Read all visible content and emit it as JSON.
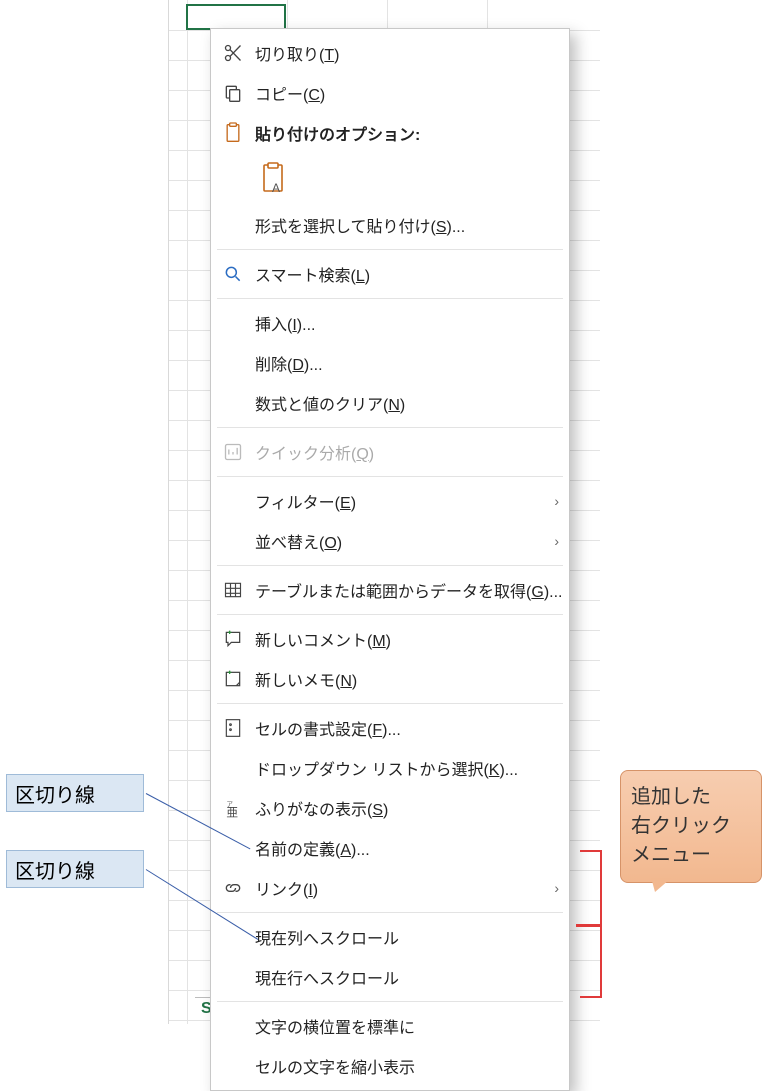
{
  "sheet": {
    "tab_label": "Sl"
  },
  "menu": {
    "cut": "切り取り(<u>T</u>)",
    "copy": "コピー(<u>C</u>)",
    "paste_opts": "貼り付けのオプション:",
    "paste_special": "形式を選択して貼り付け(<u>S</u>)...",
    "smart_lookup": "スマート検索(<u>L</u>)",
    "insert": "挿入(<u>I</u>)...",
    "delete": "削除(<u>D</u>)...",
    "clear": "数式と値のクリア(<u>N</u>)",
    "quick_analysis": "クイック分析(<u>Q</u>)",
    "filter": "フィルター(<u>E</u>)",
    "sort": "並べ替え(<u>O</u>)",
    "get_data": "テーブルまたは範囲からデータを取得(<u>G</u>)...",
    "new_comment": "新しいコメント(<u>M</u>)",
    "new_note": "新しいメモ(<u>N</u>)",
    "format_cells": "セルの書式設定(<u>F</u>)...",
    "pick_list": "ドロップダウン リストから選択(<u>K</u>)...",
    "furigana": "ふりがなの表示(<u>S</u>)",
    "define_name": "名前の定義(<u>A</u>)...",
    "link": "リンク(<u>I</u>)",
    "custom1": "現在列へスクロール",
    "custom2": "現在行へスクロール",
    "custom3": "文字の横位置を標準に",
    "custom4": "セルの文字を縮小表示"
  },
  "labels": {
    "separator": "区切り線",
    "callout": "追加した\n右クリック\nメニュー"
  }
}
